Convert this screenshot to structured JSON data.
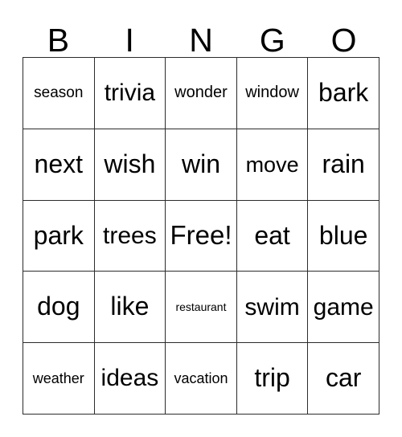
{
  "card": {
    "header_letters": [
      "B",
      "I",
      "N",
      "G",
      "O"
    ],
    "columns": 5,
    "rows": 5,
    "free_space_label": "Free!",
    "free_space_position": {
      "row": 3,
      "column": 3
    },
    "grid_line_color": "#2b2b2b",
    "background_color": "#ffffff",
    "text_color": "#000000",
    "cells": [
      [
        {
          "text": "season",
          "size": "sm"
        },
        {
          "text": "trivia",
          "size": "xl"
        },
        {
          "text": "wonder",
          "size": "m"
        },
        {
          "text": "window",
          "size": "m"
        },
        {
          "text": "bark",
          "size": "xxl"
        }
      ],
      [
        {
          "text": "next",
          "size": "xxl"
        },
        {
          "text": "wish",
          "size": "xxl"
        },
        {
          "text": "win",
          "size": "xxl"
        },
        {
          "text": "move",
          "size": "l"
        },
        {
          "text": "rain",
          "size": "xxl"
        }
      ],
      [
        {
          "text": "park",
          "size": "xxl"
        },
        {
          "text": "trees",
          "size": "xl"
        },
        {
          "text": "Free!",
          "size": "fr"
        },
        {
          "text": "eat",
          "size": "xxl"
        },
        {
          "text": "blue",
          "size": "xxl"
        }
      ],
      [
        {
          "text": "dog",
          "size": "xxl"
        },
        {
          "text": "like",
          "size": "xxl"
        },
        {
          "text": "restaurant",
          "size": "xs"
        },
        {
          "text": "swim",
          "size": "xl"
        },
        {
          "text": "game",
          "size": "xl"
        }
      ],
      [
        {
          "text": "weather",
          "size": "s"
        },
        {
          "text": "ideas",
          "size": "xl"
        },
        {
          "text": "vacation",
          "size": "s"
        },
        {
          "text": "trip",
          "size": "xxl"
        },
        {
          "text": "car",
          "size": "xxl"
        }
      ]
    ]
  }
}
